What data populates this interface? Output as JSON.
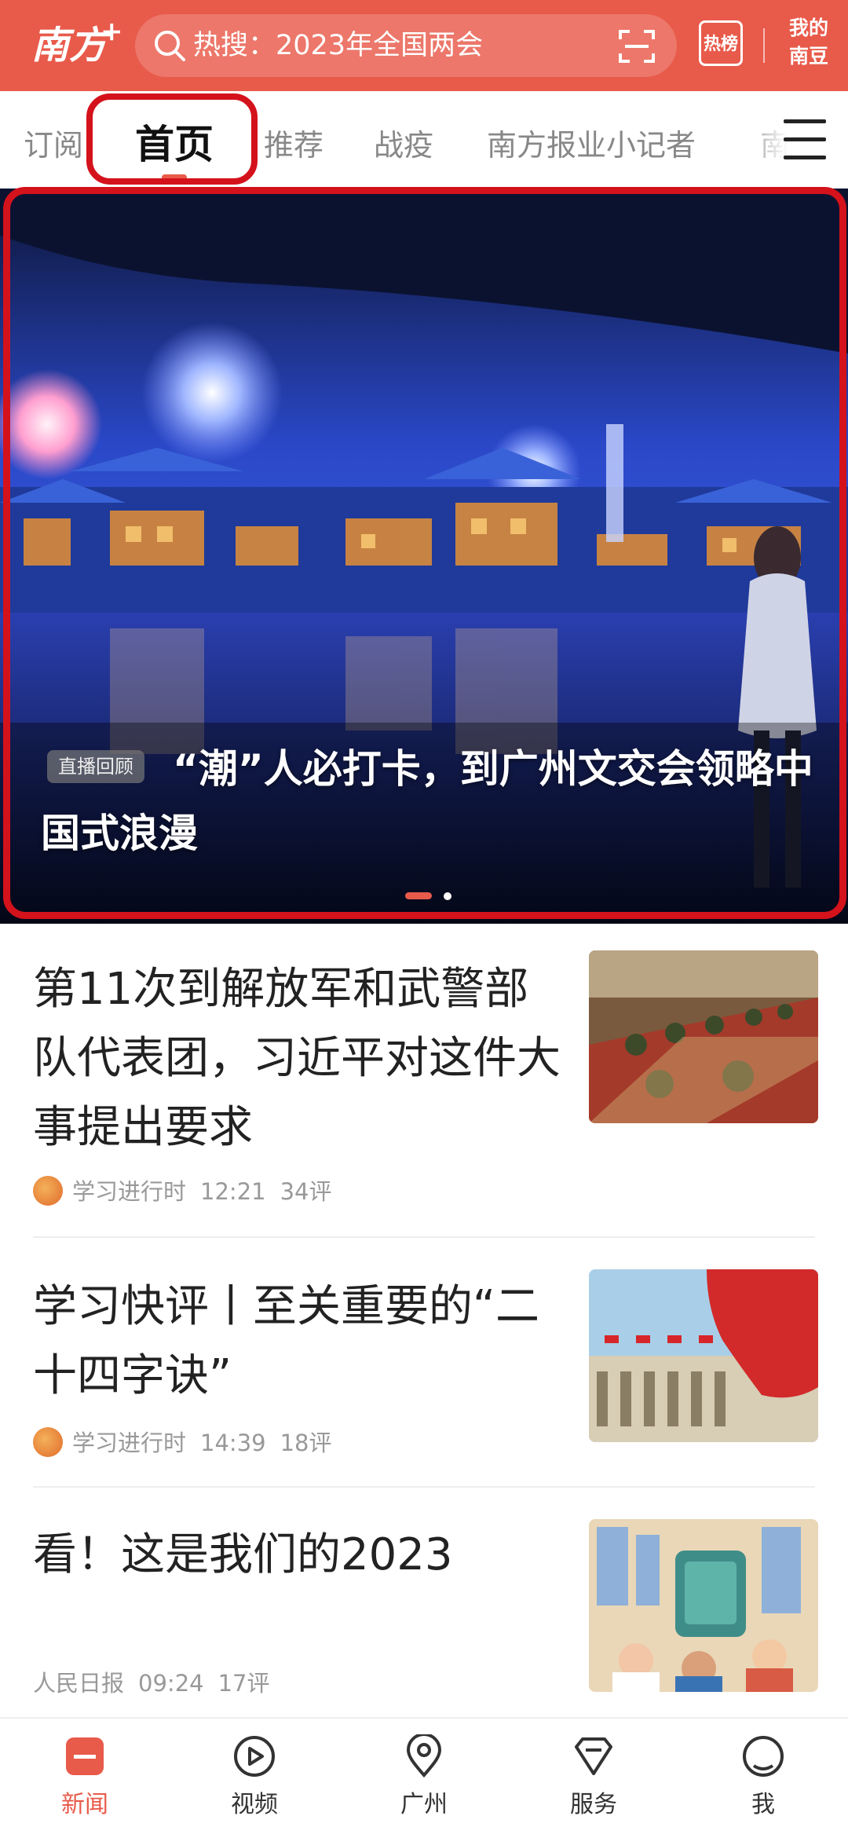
{
  "header": {
    "logo_text": "南方",
    "logo_plus": "+",
    "search_placeholder": "热搜：2023年全国两会",
    "hot_rank_label": "热榜",
    "my_account_label_line1": "我的",
    "my_account_label_line2": "南豆"
  },
  "tabs": [
    {
      "label": "订阅",
      "active": false
    },
    {
      "label": "首页",
      "active": true
    },
    {
      "label": "推荐",
      "active": false
    },
    {
      "label": "战疫",
      "active": false
    },
    {
      "label": "南方报业小记者",
      "active": false
    },
    {
      "label": "南",
      "active": false
    }
  ],
  "hero": {
    "badge": "直播回顾",
    "title": "“潮”人必打卡，到广州文交会领略中国式浪漫",
    "carousel_total": 2,
    "carousel_current": 1
  },
  "news": [
    {
      "title": "第11次到解放军和武警部队代表团，习近平对这件大事提出要求",
      "source": "学习进行时",
      "time": "12:21",
      "comments": "34评",
      "has_source_icon": true
    },
    {
      "title": "学习快评丨至关重要的“二十四字诀”",
      "source": "学习进行时",
      "time": "14:39",
      "comments": "18评",
      "has_source_icon": true
    },
    {
      "title": "看！这是我们的2023",
      "source": "人民日报",
      "time": "09:24",
      "comments": "17评",
      "has_source_icon": false
    }
  ],
  "bottom_nav": [
    {
      "label": "新闻",
      "icon": "news-icon",
      "active": true
    },
    {
      "label": "视频",
      "icon": "video-icon",
      "active": false
    },
    {
      "label": "广州",
      "icon": "location-icon",
      "active": false
    },
    {
      "label": "服务",
      "icon": "service-icon",
      "active": false
    },
    {
      "label": "我",
      "icon": "profile-icon",
      "active": false
    }
  ],
  "colors": {
    "brand": "#e85a4a",
    "highlight": "#d4121b"
  }
}
